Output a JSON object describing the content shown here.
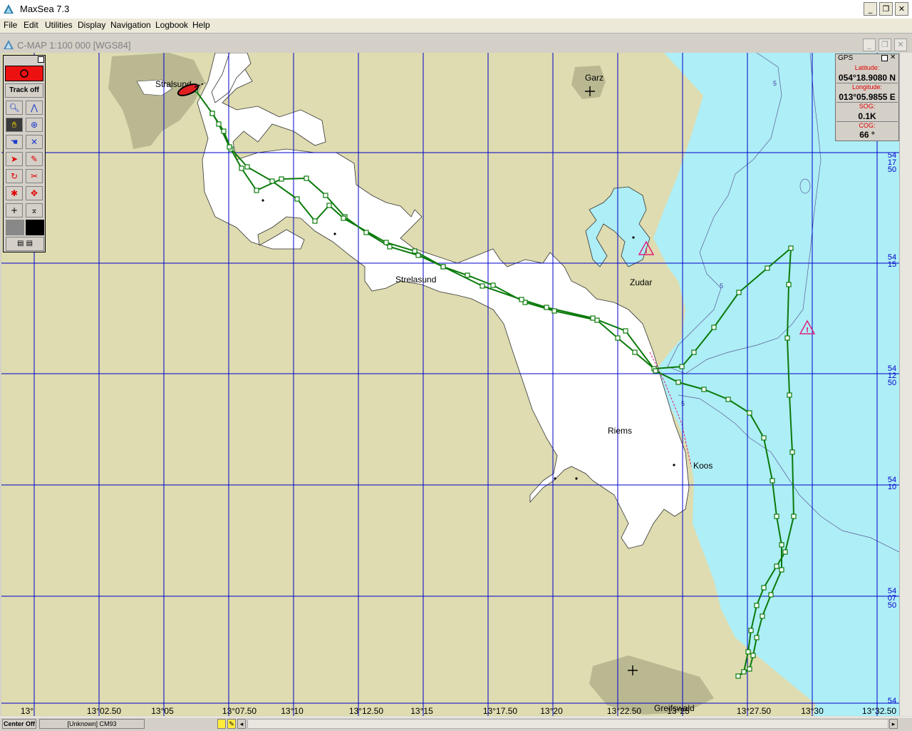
{
  "window": {
    "title": "MaxSea 7.3"
  },
  "menu": [
    "File",
    "Edit",
    "Utilities",
    "Display",
    "Navigation",
    "Logbook",
    "Help"
  ],
  "chart_window": {
    "title": "C-MAP  1:100 000 [WGS84]"
  },
  "toolbox": {
    "track_label": "Track off"
  },
  "gps": {
    "title": "GPS",
    "latitude_label": "Latitude:",
    "latitude": "054°18.9080 N",
    "longitude_label": "Longitude:",
    "longitude": "013°05.9855 E",
    "sog_label": "SOG:",
    "sog": "0.1K",
    "cog_label": "COG:",
    "cog": "66 °"
  },
  "places": [
    {
      "name": "Stralsund"
    },
    {
      "name": "Garz"
    },
    {
      "name": "Strelasund"
    },
    {
      "name": "Zudar"
    },
    {
      "name": "Riems"
    },
    {
      "name": "Koos"
    },
    {
      "name": "Greifswald"
    }
  ],
  "depth_labels": [
    "5",
    "5",
    "5"
  ],
  "lon_labels": [
    "13°",
    "13°02.50",
    "13°05",
    "13°07.50",
    "13°10",
    "13°12.50",
    "13°15",
    "13°17.50",
    "13°20",
    "13°22.50",
    "13°25",
    "13°27.50",
    "13°30",
    "13°32.50"
  ],
  "lat_labels": [
    {
      "deg": "54",
      "min": "17",
      "sec": "50"
    },
    {
      "deg": "54",
      "min": "15",
      "sec": ""
    },
    {
      "deg": "54",
      "min": "12",
      "sec": "50"
    },
    {
      "deg": "54",
      "min": "10",
      "sec": ""
    },
    {
      "deg": "54",
      "min": "07",
      "sec": "50"
    },
    {
      "deg": "54",
      "min": "",
      "sec": ""
    }
  ],
  "status": {
    "center": "Center Off",
    "chart": "[Unknown]  CM93"
  },
  "colors": {
    "land": "#dedcb0",
    "water": "#ffffff",
    "deep": "#aeeef6",
    "grid": "#0000cc",
    "track": "#0a7a0a",
    "boat": "#e02020",
    "warning": "#e0207a"
  }
}
